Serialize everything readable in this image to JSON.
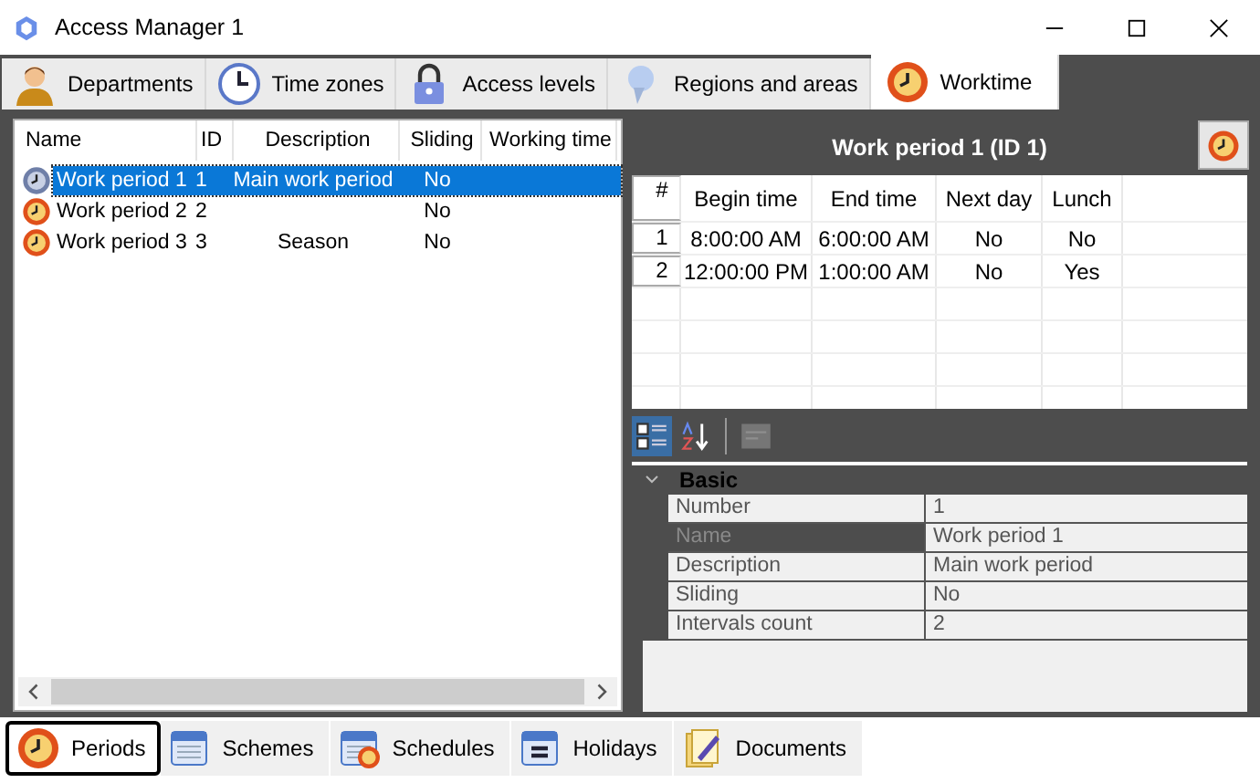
{
  "window": {
    "title": "Access Manager 1"
  },
  "top_tabs": [
    {
      "label": "Departments",
      "kind": "person",
      "selected": false
    },
    {
      "label": "Time zones",
      "kind": "clock",
      "selected": false
    },
    {
      "label": "Access levels",
      "kind": "lock",
      "selected": false
    },
    {
      "label": "Regions and areas",
      "kind": "pin",
      "selected": false
    },
    {
      "label": "Worktime",
      "kind": "worktime",
      "selected": true
    }
  ],
  "periods_table": {
    "columns": [
      "Name",
      "ID",
      "Description",
      "Sliding",
      "Working time"
    ],
    "rows": [
      {
        "cells": [
          "Work period 1",
          "1",
          "Main work period",
          "No"
        ],
        "selected": true
      },
      {
        "cells": [
          "Work period 2",
          "2",
          "",
          "No"
        ],
        "selected": false
      },
      {
        "cells": [
          "Work period 3",
          "3",
          "Season",
          "No"
        ],
        "selected": false
      }
    ]
  },
  "detail": {
    "title": "Work period 1 (ID 1)",
    "intervals": {
      "columns": [
        "#",
        "Begin time",
        "End time",
        "Next day",
        "Lunch"
      ],
      "rows": [
        {
          "cells": [
            "1",
            "8:00:00 AM",
            "6:00:00 AM",
            "No",
            "No"
          ]
        },
        {
          "cells": [
            "2",
            "12:00:00 PM",
            "1:00:00 AM",
            "No",
            "Yes"
          ]
        }
      ]
    },
    "toolbar": [
      {
        "kind": "categorized",
        "selected": true,
        "disabled": false
      },
      {
        "kind": "alphabetical",
        "selected": false,
        "disabled": false
      },
      {
        "kind": "pages",
        "selected": false,
        "disabled": true
      }
    ],
    "properties": {
      "category": "Basic",
      "expanded": true,
      "rows": [
        {
          "name": "Number",
          "value": "1",
          "selected": false
        },
        {
          "name": "Name",
          "value": "Work period 1",
          "selected": true
        },
        {
          "name": "Description",
          "value": "Main work period",
          "selected": false
        },
        {
          "name": "Sliding",
          "value": "No",
          "selected": false
        },
        {
          "name": "Intervals count",
          "value": "2",
          "selected": false
        }
      ]
    }
  },
  "bottom_tabs": [
    {
      "label": "Periods",
      "kind": "worktime",
      "selected": true
    },
    {
      "label": "Schemes",
      "kind": "calendar",
      "selected": false
    },
    {
      "label": "Schedules",
      "kind": "calclock",
      "selected": false
    },
    {
      "label": "Holidays",
      "kind": "holiday",
      "selected": false
    },
    {
      "label": "Documents",
      "kind": "docs",
      "selected": false
    }
  ]
}
